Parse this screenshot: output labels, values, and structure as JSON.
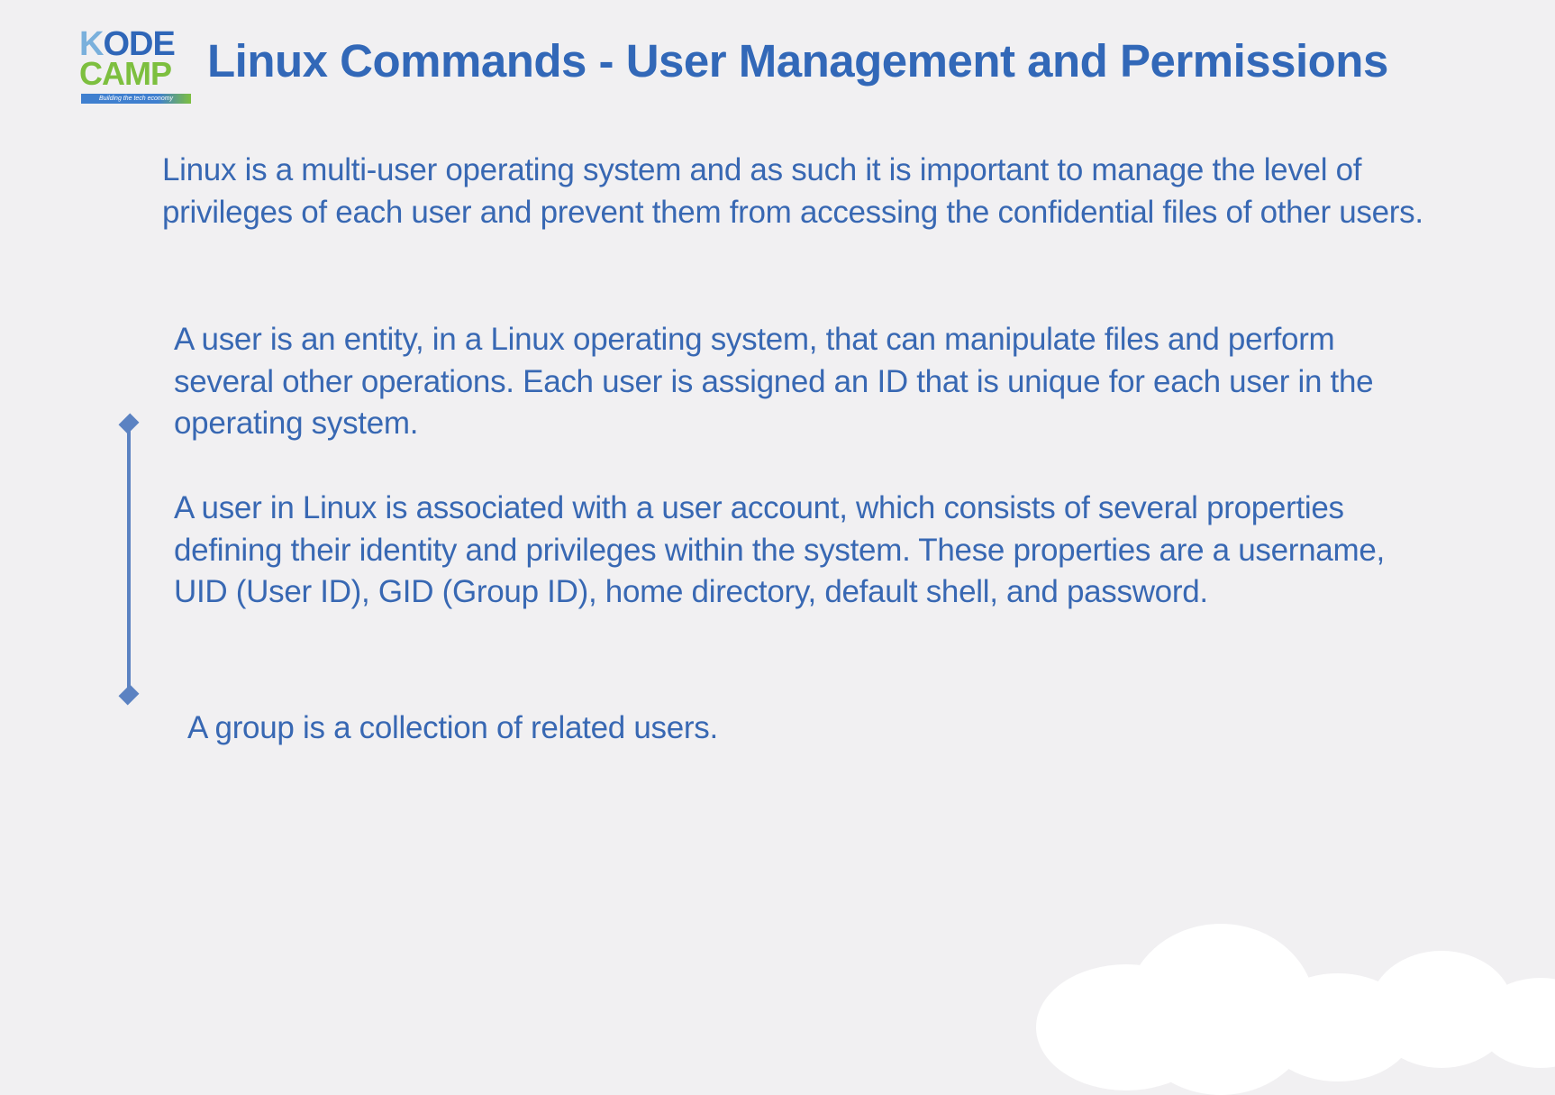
{
  "logo": {
    "line1_k": "K",
    "line1_rest": "ODE",
    "line2": "CAMP",
    "tagline": "Building the tech economy"
  },
  "slide": {
    "title": "Linux Commands - User Management and Permissions",
    "paragraphs": {
      "intro": "Linux is a multi-user operating system and as such it is important to manage the level of privileges of each user and prevent them from accessing the confidential files of other users.",
      "user": "A user is an entity, in a Linux operating system, that can manipulate files and perform several other operations. Each user is assigned an ID that is unique for each user in the operating system.",
      "account": "A user in Linux is associated with a user account, which consists of several properties defining their identity and privileges within the system. These properties are a username, UID (User ID), GID (Group ID), home directory, default shell, and password.",
      "group": "A group is a collection of related users."
    }
  },
  "colors": {
    "background": "#f1f0f2",
    "text": "#3868b3",
    "title": "#3268b8",
    "accent_green": "#7dbf3f",
    "timeline": "#5b82c2"
  },
  "icons": {
    "timeline_markers": "diamond"
  }
}
